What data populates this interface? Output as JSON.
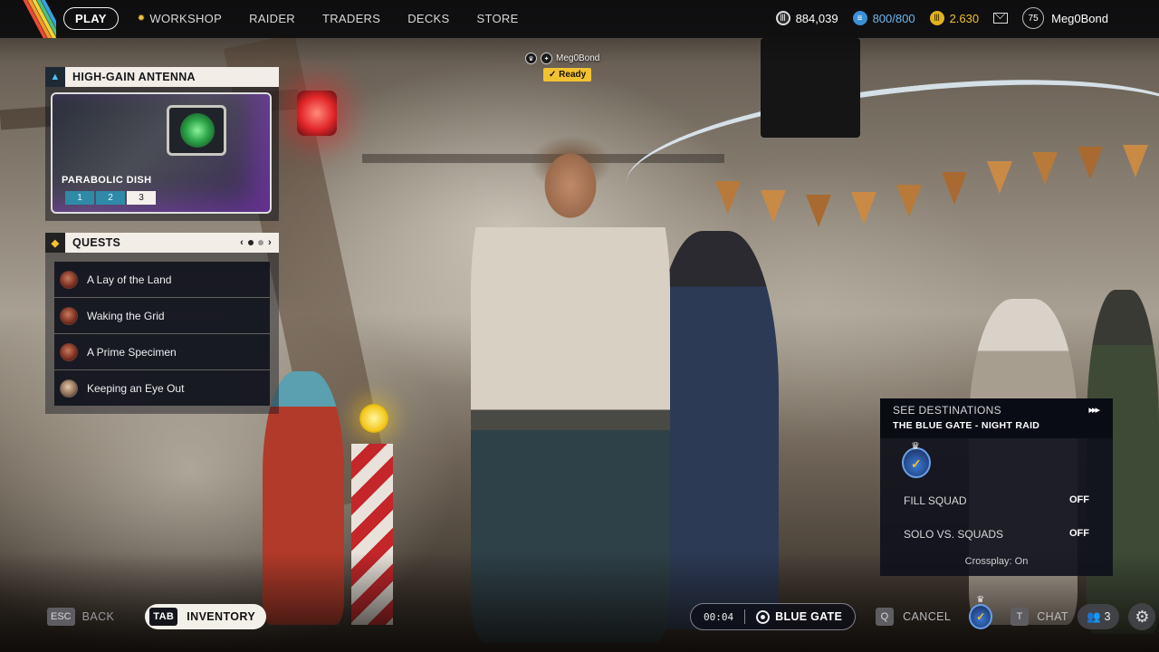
{
  "nav": {
    "items": [
      "PLAY",
      "WORKSHOP",
      "RAIDER",
      "TRADERS",
      "DECKS",
      "STORE"
    ],
    "active": "PLAY"
  },
  "currencies": {
    "coins": "884,039",
    "credits": "800/800",
    "tokens": "2.630"
  },
  "user": {
    "level": "75",
    "name": "Meg0Bond"
  },
  "antenna": {
    "title": "HIGH-GAIN ANTENNA",
    "card_title": "PARABOLIC DISH",
    "tiers": [
      "1",
      "2",
      "3"
    ],
    "current_tier": "3"
  },
  "quests": {
    "title": "QUESTS",
    "pager_prev": "‹",
    "pager_next": "›",
    "items": [
      {
        "label": "A Lay of the Land"
      },
      {
        "label": "Waking the Grid"
      },
      {
        "label": "A Prime Specimen"
      },
      {
        "label": "Keeping an Eye Out"
      }
    ]
  },
  "player_tag": {
    "name": "Meg0Bond",
    "status": "Ready"
  },
  "destination": {
    "see_label": "SEE DESTINATIONS",
    "name": "THE BLUE GATE - NIGHT RAID",
    "fill_squad_label": "FILL SQUAD",
    "fill_squad_value": "OFF",
    "solo_label": "SOLO VS. SQUADS",
    "solo_value": "OFF",
    "crossplay": "Crossplay: On"
  },
  "bottom": {
    "esc_key": "ESC",
    "back_label": "BACK",
    "tab_key": "TAB",
    "inventory_label": "INVENTORY",
    "timer": "00:04",
    "map_label": "BLUE GATE",
    "cancel_key": "Q",
    "cancel_label": "CANCEL",
    "chat_key": "T",
    "chat_label": "CHAT",
    "friends_count": "3"
  },
  "colors": {
    "accent_yellow": "#f2c230",
    "credits_blue": "#6fb7f0",
    "panel_header": "#f2ede6"
  }
}
